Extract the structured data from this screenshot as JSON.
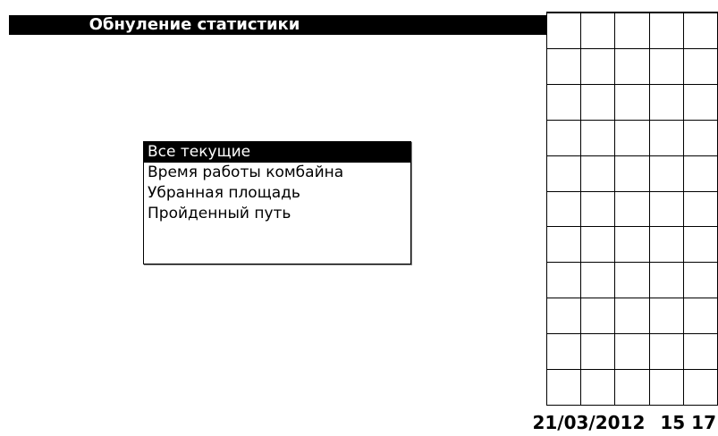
{
  "title": "Обнуление статистики",
  "menu": {
    "items": [
      {
        "label": "Все текущие",
        "selected": true
      },
      {
        "label": "Время работы комбайна",
        "selected": false
      },
      {
        "label": "Убранная площадь",
        "selected": false
      },
      {
        "label": "Пройденный путь",
        "selected": false
      }
    ]
  },
  "status": {
    "date": "21/03/2012",
    "time": "15 17"
  },
  "colors": {
    "background": "#ffffff",
    "foreground": "#000000",
    "selection": "#000000"
  }
}
